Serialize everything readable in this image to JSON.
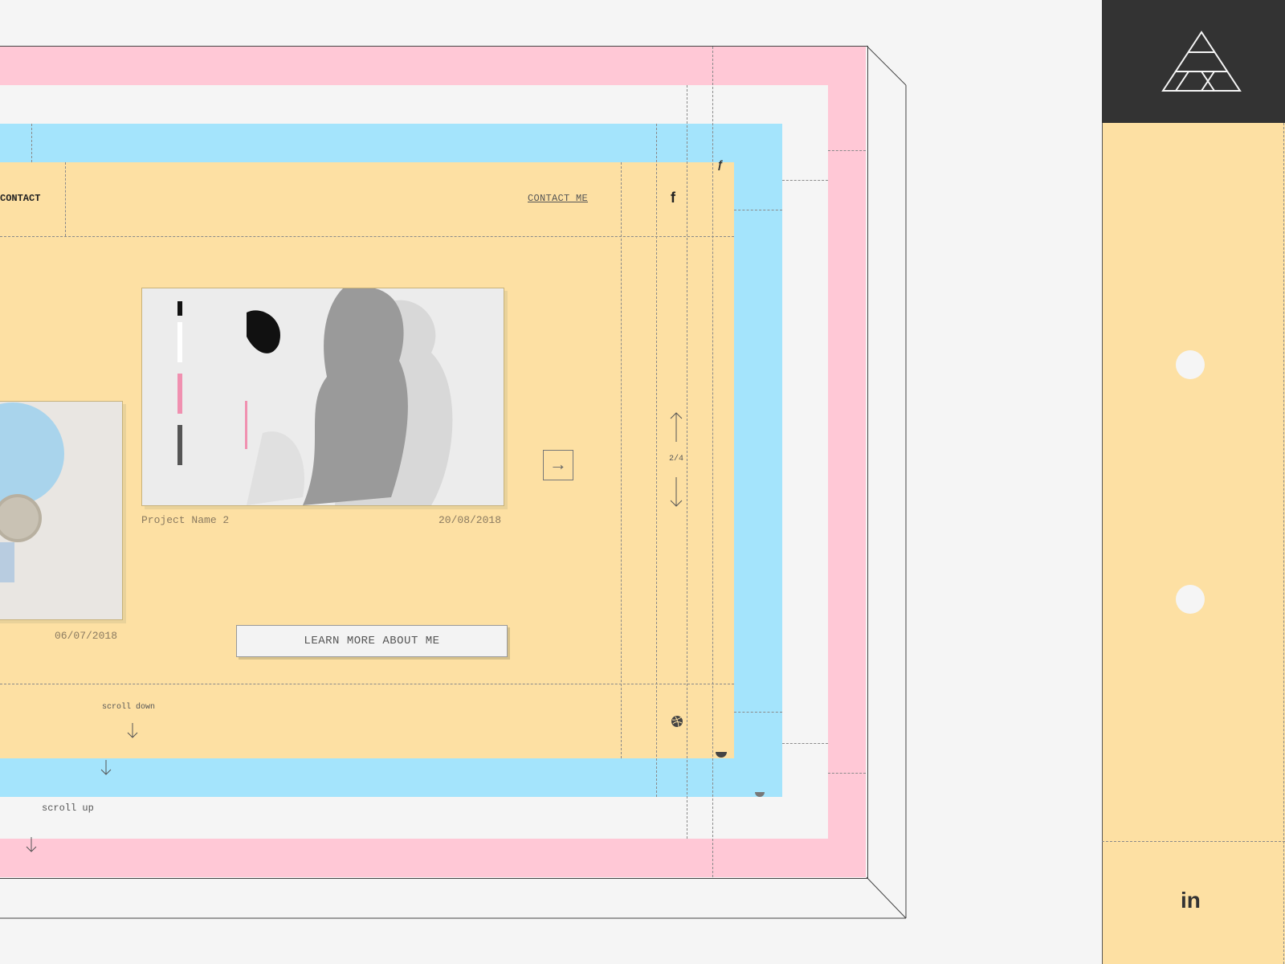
{
  "header": {
    "nav_contact": "CONTACT",
    "contact_link": "CONTACT ME",
    "facebook_icon": "facebook-icon",
    "facebook_glyph": "f"
  },
  "projects": [
    {
      "name": "Project Name 2",
      "date": "20/08/2018"
    },
    {
      "name": "",
      "date": "06/07/2018"
    }
  ],
  "pager": {
    "label": "2/4"
  },
  "cta": {
    "learn_more": "LEARN MORE ABOUT ME"
  },
  "scroll": {
    "down_label": "scroll down",
    "up_label": "scroll up"
  },
  "sidebar": {
    "linkedin_glyph": "in",
    "logo_icon": "triangle-logo-icon"
  },
  "colors": {
    "pink": "#ffc8d6",
    "blue": "#a4e4fc",
    "yellow": "#fde0a3",
    "dark": "#333333"
  }
}
